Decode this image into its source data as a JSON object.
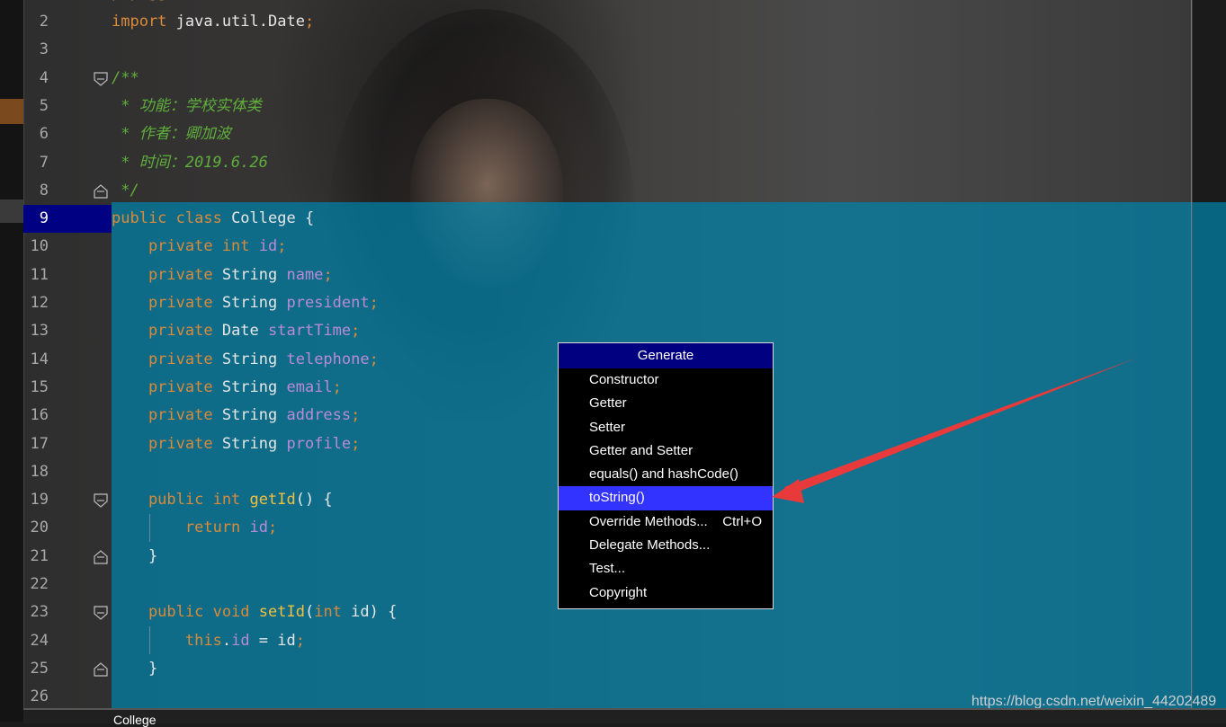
{
  "editor": {
    "lines": [
      {
        "n": "2",
        "tokens": [
          {
            "t": "import ",
            "c": "kw"
          },
          {
            "t": "java.util.Date",
            "c": "plain"
          },
          {
            "t": ";",
            "c": "kw"
          }
        ]
      },
      {
        "n": "3",
        "tokens": []
      },
      {
        "n": "4",
        "tokens": [
          {
            "t": "/**",
            "c": "cm"
          }
        ]
      },
      {
        "n": "5",
        "tokens": [
          {
            "t": " * 功能：学校实体类",
            "c": "cm"
          }
        ]
      },
      {
        "n": "6",
        "tokens": [
          {
            "t": " * 作者：卿加波",
            "c": "cm"
          }
        ]
      },
      {
        "n": "7",
        "tokens": [
          {
            "t": " * 时间：2019.6.26",
            "c": "cm"
          }
        ]
      },
      {
        "n": "8",
        "tokens": [
          {
            "t": " */",
            "c": "cm"
          }
        ]
      },
      {
        "n": "9",
        "tokens": [
          {
            "t": "public class ",
            "c": "kw"
          },
          {
            "t": "College {",
            "c": "plain"
          }
        ]
      },
      {
        "n": "10",
        "tokens": [
          {
            "t": "    private int ",
            "c": "kw"
          },
          {
            "t": "id",
            "c": "fld"
          },
          {
            "t": ";",
            "c": "kw"
          }
        ]
      },
      {
        "n": "11",
        "tokens": [
          {
            "t": "    private ",
            "c": "kw"
          },
          {
            "t": "String ",
            "c": "plain"
          },
          {
            "t": "name",
            "c": "fld"
          },
          {
            "t": ";",
            "c": "kw"
          }
        ]
      },
      {
        "n": "12",
        "tokens": [
          {
            "t": "    private ",
            "c": "kw"
          },
          {
            "t": "String ",
            "c": "plain"
          },
          {
            "t": "president",
            "c": "fld"
          },
          {
            "t": ";",
            "c": "kw"
          }
        ]
      },
      {
        "n": "13",
        "tokens": [
          {
            "t": "    private ",
            "c": "kw"
          },
          {
            "t": "Date ",
            "c": "plain"
          },
          {
            "t": "startTime",
            "c": "fld"
          },
          {
            "t": ";",
            "c": "kw"
          }
        ]
      },
      {
        "n": "14",
        "tokens": [
          {
            "t": "    private ",
            "c": "kw"
          },
          {
            "t": "String ",
            "c": "plain"
          },
          {
            "t": "telephone",
            "c": "fld"
          },
          {
            "t": ";",
            "c": "kw"
          }
        ]
      },
      {
        "n": "15",
        "tokens": [
          {
            "t": "    private ",
            "c": "kw"
          },
          {
            "t": "String ",
            "c": "plain"
          },
          {
            "t": "email",
            "c": "fld"
          },
          {
            "t": ";",
            "c": "kw"
          }
        ]
      },
      {
        "n": "16",
        "tokens": [
          {
            "t": "    private ",
            "c": "kw"
          },
          {
            "t": "String ",
            "c": "plain"
          },
          {
            "t": "address",
            "c": "fld"
          },
          {
            "t": ";",
            "c": "kw"
          }
        ]
      },
      {
        "n": "17",
        "tokens": [
          {
            "t": "    private ",
            "c": "kw"
          },
          {
            "t": "String ",
            "c": "plain"
          },
          {
            "t": "profile",
            "c": "fld"
          },
          {
            "t": ";",
            "c": "kw"
          }
        ]
      },
      {
        "n": "18",
        "tokens": []
      },
      {
        "n": "19",
        "tokens": [
          {
            "t": "    public int ",
            "c": "kw"
          },
          {
            "t": "getId",
            "c": "mth"
          },
          {
            "t": "() {",
            "c": "plain"
          }
        ]
      },
      {
        "n": "20",
        "tokens": [
          {
            "t": "        return ",
            "c": "kw"
          },
          {
            "t": "id",
            "c": "fld"
          },
          {
            "t": ";",
            "c": "kw"
          }
        ]
      },
      {
        "n": "21",
        "tokens": [
          {
            "t": "    }",
            "c": "plain"
          }
        ]
      },
      {
        "n": "22",
        "tokens": []
      },
      {
        "n": "23",
        "tokens": [
          {
            "t": "    public void ",
            "c": "kw"
          },
          {
            "t": "setId",
            "c": "mth"
          },
          {
            "t": "(",
            "c": "plain"
          },
          {
            "t": "int ",
            "c": "kw"
          },
          {
            "t": "id) {",
            "c": "plain"
          }
        ]
      },
      {
        "n": "24",
        "tokens": [
          {
            "t": "        this",
            "c": "kw"
          },
          {
            "t": ".",
            "c": "plain"
          },
          {
            "t": "id",
            "c": "fld"
          },
          {
            "t": " = id",
            "c": "plain"
          },
          {
            "t": ";",
            "c": "kw"
          }
        ]
      },
      {
        "n": "25",
        "tokens": [
          {
            "t": "    }",
            "c": "plain"
          }
        ]
      },
      {
        "n": "26",
        "tokens": []
      }
    ],
    "current_line": "9",
    "fold_open_lines": [
      "4",
      "19",
      "23"
    ],
    "fold_close_lines": [
      "8",
      "21",
      "25"
    ]
  },
  "popup": {
    "title": "Generate",
    "items": [
      {
        "label": "Constructor",
        "shortcut": "",
        "selected": false
      },
      {
        "label": "Getter",
        "shortcut": "",
        "selected": false
      },
      {
        "label": "Setter",
        "shortcut": "",
        "selected": false
      },
      {
        "label": "Getter and Setter",
        "shortcut": "",
        "selected": false
      },
      {
        "label": "equals() and hashCode()",
        "shortcut": "",
        "selected": false
      },
      {
        "label": "toString()",
        "shortcut": "",
        "selected": true
      },
      {
        "label": "Override Methods...",
        "shortcut": "Ctrl+O",
        "selected": false
      },
      {
        "label": "Delegate Methods...",
        "shortcut": "",
        "selected": false
      },
      {
        "label": "Test...",
        "shortcut": "",
        "selected": false
      },
      {
        "label": "Copyright",
        "shortcut": "",
        "selected": false
      }
    ]
  },
  "tab": {
    "label": "College"
  },
  "watermark": {
    "text": "https://blog.csdn.net/weixin_44202489"
  },
  "colors": {
    "keyword": "#d98a3a",
    "comment": "#5fae3c",
    "field": "#b98ad6",
    "method": "#f0c040",
    "popup_selected": "#3333ff",
    "popup_title": "#000080",
    "arrow": "#e83a3a"
  }
}
